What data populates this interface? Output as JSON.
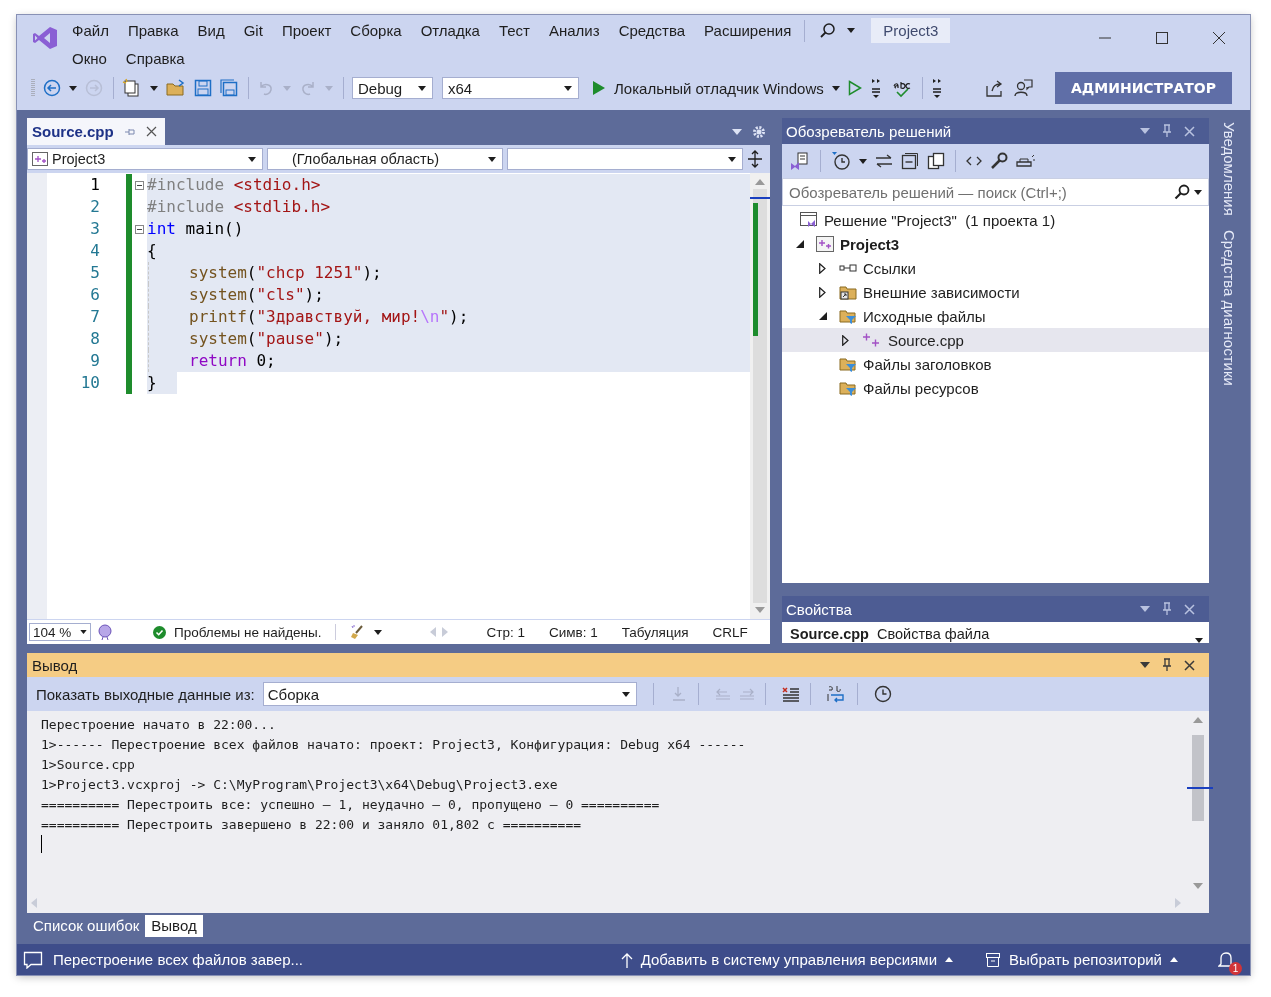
{
  "title_bar": {
    "menu": [
      "Файл",
      "Правка",
      "Вид",
      "Git",
      "Проект",
      "Сборка",
      "Отладка",
      "Тест",
      "Анализ",
      "Средства",
      "Расширения"
    ],
    "menu_row2": [
      "Окно",
      "Справка"
    ],
    "project_badge": "Project3"
  },
  "toolbar": {
    "configuration": "Debug",
    "platform": "x64",
    "debugger": "Локальный отладчик Windows",
    "account": "АДМИНИСТРАТОР"
  },
  "editor": {
    "tab": {
      "label": "Source.cpp",
      "selected": true
    },
    "nav": {
      "project": "Project3",
      "scope": "(Глобальная область)"
    },
    "lines": [
      {
        "number": "1",
        "fold": true,
        "indented": false,
        "selected": true,
        "tokens": [
          {
            "text": "#include ",
            "kind": "directive"
          },
          {
            "text": "<stdio.h>",
            "kind": "header"
          }
        ]
      },
      {
        "number": "2",
        "fold": false,
        "indented": false,
        "selected": true,
        "tokens": [
          {
            "text": "#include ",
            "kind": "directive"
          },
          {
            "text": "<stdlib.h>",
            "kind": "header"
          }
        ]
      },
      {
        "number": "3",
        "fold": true,
        "indented": false,
        "selected": true,
        "tokens": [
          {
            "text": "int",
            "kind": "keyword"
          },
          {
            "text": " main()",
            "kind": "plain"
          }
        ]
      },
      {
        "number": "4",
        "fold": false,
        "indented": false,
        "selected": true,
        "tokens": [
          {
            "text": "{",
            "kind": "plain"
          }
        ]
      },
      {
        "number": "5",
        "fold": false,
        "indented": true,
        "selected": true,
        "tokens": [
          {
            "text": "system",
            "kind": "function"
          },
          {
            "text": "(",
            "kind": "plain"
          },
          {
            "text": "\"chcp 1251\"",
            "kind": "string"
          },
          {
            "text": ");",
            "kind": "plain"
          }
        ]
      },
      {
        "number": "6",
        "fold": false,
        "indented": true,
        "selected": true,
        "tokens": [
          {
            "text": "system",
            "kind": "function"
          },
          {
            "text": "(",
            "kind": "plain"
          },
          {
            "text": "\"cls\"",
            "kind": "string"
          },
          {
            "text": ");",
            "kind": "plain"
          }
        ]
      },
      {
        "number": "7",
        "fold": false,
        "indented": true,
        "selected": true,
        "tokens": [
          {
            "text": "printf",
            "kind": "function"
          },
          {
            "text": "(",
            "kind": "plain"
          },
          {
            "text": "\"Здравствуй, мир!",
            "kind": "string"
          },
          {
            "text": "\\n",
            "kind": "escape"
          },
          {
            "text": "\"",
            "kind": "string"
          },
          {
            "text": ");",
            "kind": "plain"
          }
        ]
      },
      {
        "number": "8",
        "fold": false,
        "indented": true,
        "selected": true,
        "tokens": [
          {
            "text": "system",
            "kind": "function"
          },
          {
            "text": "(",
            "kind": "plain"
          },
          {
            "text": "\"pause\"",
            "kind": "string"
          },
          {
            "text": ");",
            "kind": "plain"
          }
        ]
      },
      {
        "number": "9",
        "fold": false,
        "indented": true,
        "selected": true,
        "tokens": [
          {
            "text": "return",
            "kind": "control"
          },
          {
            "text": " 0;",
            "kind": "plain"
          }
        ]
      },
      {
        "number": "10",
        "fold": false,
        "indented": false,
        "selected": true,
        "tokens": [
          {
            "text": "}",
            "kind": "plain"
          }
        ]
      }
    ],
    "status": {
      "zoom": "104 %",
      "problems": "Проблемы не найдены.",
      "line": "Стр: 1",
      "col": "Симв: 1",
      "indent": "Табуляция",
      "eol": "CRLF"
    }
  },
  "solution_explorer": {
    "title": "Обозреватель решений",
    "search": {
      "placeholder": "Обозреватель решений — поиск (Ctrl+;)"
    },
    "tree": [
      {
        "label": "Решение \"Project3\"  (1 проекта 1)",
        "kind": "solution",
        "selected": false,
        "children": [
          {
            "label": "Project3",
            "kind": "project",
            "expandable": true,
            "expanded": true,
            "selected": false,
            "children": [
              {
                "label": "Ссылки",
                "kind": "references",
                "expandable": true,
                "expanded": false,
                "selected": false
              },
              {
                "label": "Внешние зависимости",
                "kind": "external",
                "expandable": true,
                "expanded": false,
                "selected": false
              },
              {
                "label": "Исходные файлы",
                "kind": "filter",
                "expandable": true,
                "expanded": true,
                "selected": false,
                "children": [
                  {
                    "label": "Source.cpp",
                    "kind": "cpp",
                    "expandable": true,
                    "expanded": false,
                    "selected": true
                  }
                ]
              },
              {
                "label": "Файлы заголовков",
                "kind": "filter",
                "expandable": false,
                "selected": false
              },
              {
                "label": "Файлы ресурсов",
                "kind": "filter",
                "expandable": false,
                "selected": false
              }
            ]
          }
        ]
      }
    ]
  },
  "properties": {
    "title": "Свойства",
    "object": "Source.cpp",
    "object_type": "Свойства файла"
  },
  "side_tabs": [
    "Уведомления",
    "Средства диагностики"
  ],
  "output": {
    "title": "Вывод",
    "source_label": "Показать выходные данные из:",
    "source": "Сборка",
    "lines": [
      "Перестроение начато в 22:00...",
      "1>------ Перестроение всех файлов начато: проект: Project3, Конфигурация: Debug x64 ------",
      "1>Source.cpp",
      "1>Project3.vcxproj -> C:\\MyProgram\\Project3\\x64\\Debug\\Project3.exe",
      "========== Перестроить все: успешно — 1, неудачно — 0, пропущено — 0 ==========",
      "========== Перестроить завершено в 22:00 и заняло 01,802 с =========="
    ]
  },
  "bottom_tabs": [
    {
      "label": "Список ошибок",
      "selected": false
    },
    {
      "label": "Вывод",
      "selected": true
    }
  ],
  "status_bar": {
    "message": "Перестроение всех файлов завер...",
    "source_control": "Добавить в систему управления версиями",
    "repository": "Выбрать репозиторий",
    "notifications": "1"
  }
}
